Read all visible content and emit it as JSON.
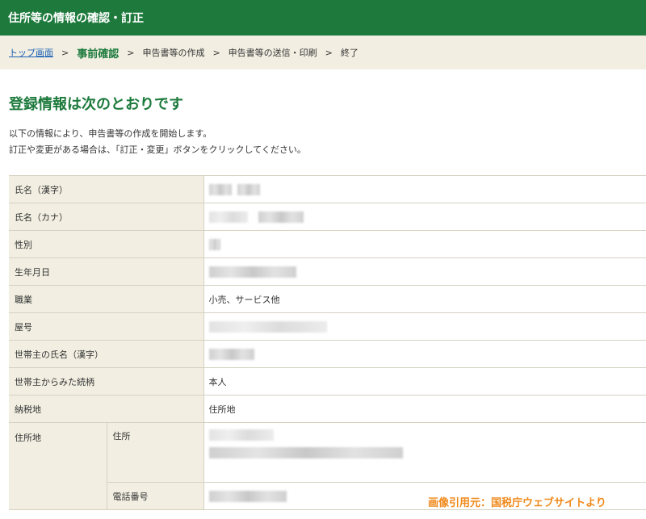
{
  "header": {
    "title": "住所等の情報の確認・訂正"
  },
  "breadcrumb": {
    "items": [
      {
        "label": "トップ画面"
      },
      {
        "label": "事前確認"
      },
      {
        "label": "申告書等の作成"
      },
      {
        "label": "申告書等の送信・印刷"
      },
      {
        "label": "終了"
      }
    ],
    "separator": ">"
  },
  "main": {
    "title": "登録情報は次のとおりです",
    "intro_line1": "以下の情報により、申告書等の作成を開始します。",
    "intro_line2": "訂正や変更がある場合は、「訂正・変更」ボタンをクリックしてください。"
  },
  "table": {
    "rows": [
      {
        "label": "氏名（漢字）",
        "value": ""
      },
      {
        "label": "氏名（カナ）",
        "value": ""
      },
      {
        "label": "性別",
        "value": ""
      },
      {
        "label": "生年月日",
        "value": ""
      },
      {
        "label": "職業",
        "value": "小売、サービス他"
      },
      {
        "label": "屋号",
        "value": ""
      },
      {
        "label": "世帯主の氏名（漢字）",
        "value": ""
      },
      {
        "label": "世帯主からみた続柄",
        "value": "本人"
      },
      {
        "label": "納税地",
        "value": "住所地"
      }
    ],
    "address_group": {
      "label": "住所地",
      "sub_address_label": "住所",
      "sub_phone_label": "電話番号"
    }
  },
  "source_note": "画像引用元：国税庁ウェブサイトより",
  "colors": {
    "accent": "#1d7a3c",
    "breadcrumb_bg": "#f2efe2",
    "note": "#f08a1c"
  }
}
